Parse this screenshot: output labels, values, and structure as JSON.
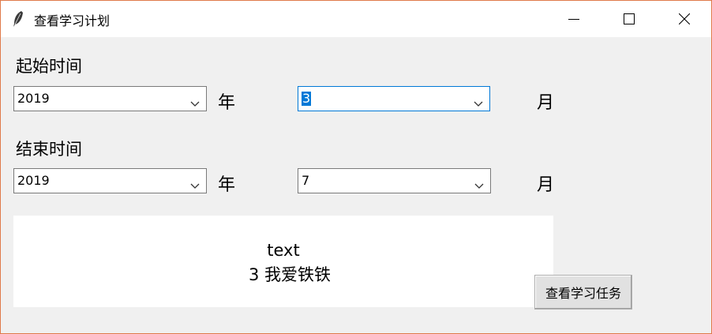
{
  "window": {
    "title": "查看学习计划",
    "accent": "#0078d7",
    "border_color": "#e07a4a"
  },
  "start": {
    "label": "起始时间",
    "year_value": "2019",
    "year_unit": "年",
    "month_value": "3",
    "month_unit": "月"
  },
  "end": {
    "label": "结束时间",
    "year_value": "2019",
    "year_unit": "年",
    "month_value": "7",
    "month_unit": "月"
  },
  "result": {
    "line1": "text",
    "line2": "3  我爱铁铁"
  },
  "actions": {
    "view_tasks_label": "查看学习任务"
  },
  "icons": {
    "app": "feather-icon",
    "minimize": "minimize-icon",
    "maximize": "maximize-icon",
    "close": "close-icon",
    "dropdown": "chevron-down-icon"
  }
}
